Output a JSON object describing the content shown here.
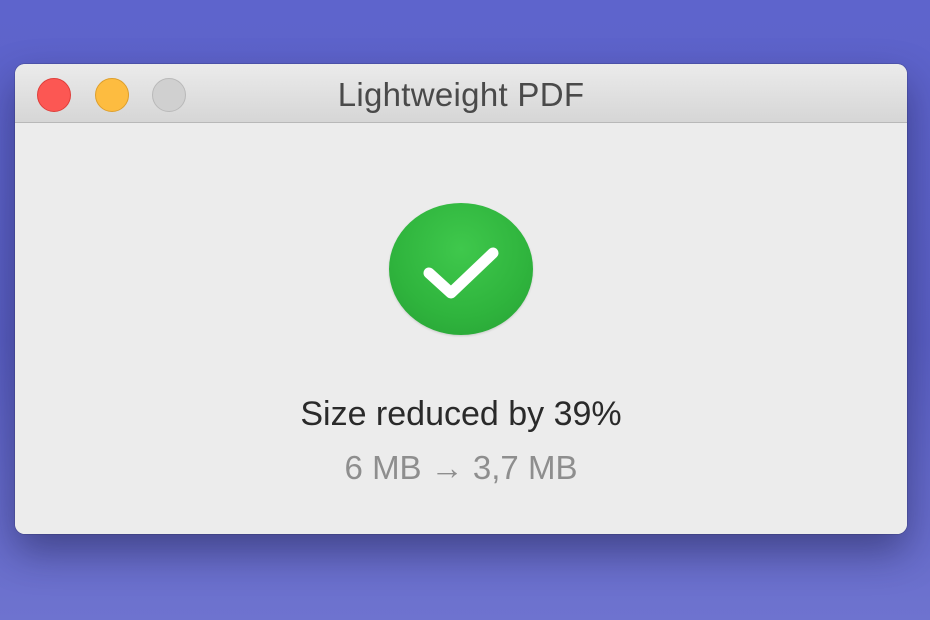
{
  "window": {
    "title": "Lightweight PDF"
  },
  "result": {
    "icon": "checkmark-circle-icon",
    "headline": "Size reduced by 39%",
    "sizes": "6 MB → 3,7 MB"
  },
  "colors": {
    "background": "#5e64cc",
    "window": "#ececec",
    "success": "#2fb43d",
    "close": "#fc5753",
    "minimize": "#fdbc40",
    "zoom_disabled": "#d0d0d0"
  }
}
